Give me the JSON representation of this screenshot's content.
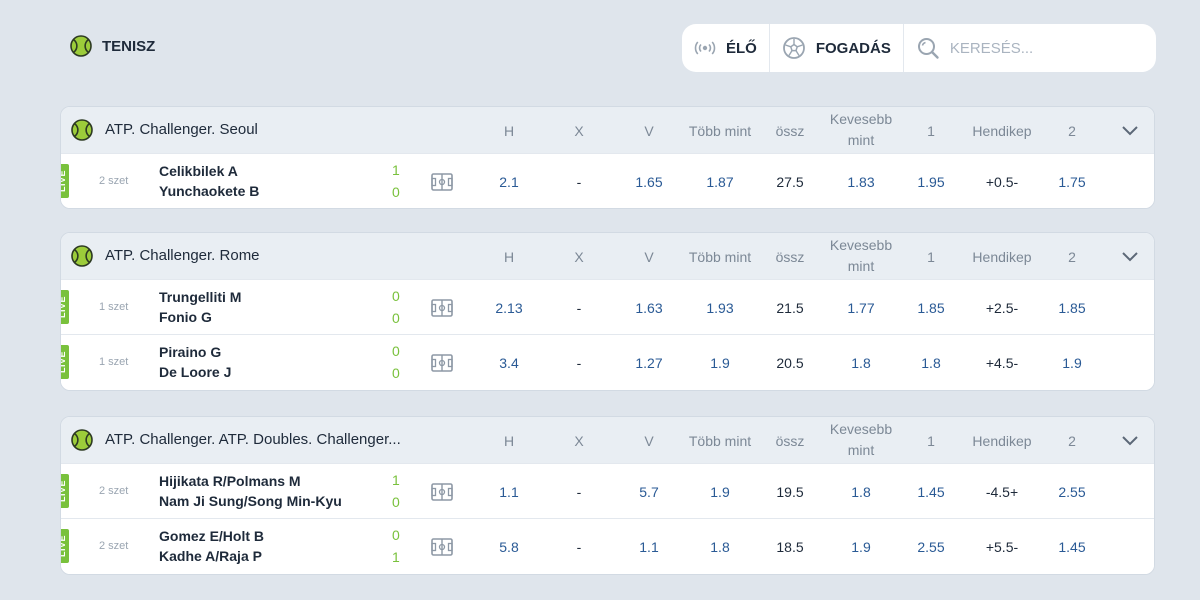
{
  "header": {
    "sport": "TENISZ",
    "live_label": "ÉLŐ",
    "bet_label": "FOGADÁS",
    "search_placeholder": "KERESÉS..."
  },
  "columns": [
    "H",
    "X",
    "V",
    "Több mint",
    "össz",
    "Kevesebb mint",
    "1",
    "Hendikep",
    "2"
  ],
  "leagues": [
    {
      "name": "ATP. Challenger. Seoul",
      "matches": [
        {
          "live": "LIVE",
          "set": "2 szet",
          "team1": "Celikbilek A",
          "team2": "Yunchaokete B",
          "score1": "1",
          "score2": "0",
          "odds": [
            "2.1",
            "-",
            "1.65",
            "1.87",
            "27.5",
            "1.83",
            "1.95",
            "+0.5-",
            "1.75"
          ]
        }
      ]
    },
    {
      "name": "ATP. Challenger. Rome",
      "matches": [
        {
          "live": "LIVE",
          "set": "1 szet",
          "team1": "Trungelliti M",
          "team2": "Fonio G",
          "score1": "0",
          "score2": "0",
          "odds": [
            "2.13",
            "-",
            "1.63",
            "1.93",
            "21.5",
            "1.77",
            "1.85",
            "+2.5-",
            "1.85"
          ]
        },
        {
          "live": "LIVE",
          "set": "1 szet",
          "team1": "Piraino G",
          "team2": "De Loore J",
          "score1": "0",
          "score2": "0",
          "odds": [
            "3.4",
            "-",
            "1.27",
            "1.9",
            "20.5",
            "1.8",
            "1.8",
            "+4.5-",
            "1.9"
          ]
        }
      ]
    },
    {
      "name": "ATP. Challenger. ATP. Doubles. Challenger...",
      "matches": [
        {
          "live": "LIVE",
          "set": "2 szet",
          "team1": "Hijikata R/Polmans M",
          "team2": "Nam Ji Sung/Song Min-Kyu",
          "score1": "1",
          "score2": "0",
          "odds": [
            "1.1",
            "-",
            "5.7",
            "1.9",
            "19.5",
            "1.8",
            "1.45",
            "-4.5+",
            "2.55"
          ]
        },
        {
          "live": "LIVE",
          "set": "2 szet",
          "team1": "Gomez E/Holt B",
          "team2": "Kadhe A/Raja P",
          "score1": "0",
          "score2": "1",
          "odds": [
            "5.8",
            "-",
            "1.1",
            "1.8",
            "18.5",
            "1.9",
            "2.55",
            "+5.5-",
            "1.45"
          ]
        }
      ]
    }
  ],
  "colors": {
    "background": "#dfe5ec",
    "live_badge": "#79c13c",
    "odd_blue": "#2a5a95",
    "header_gray": "#e9eef3"
  },
  "icons": {
    "sport": "tennis-ball-icon",
    "live": "live-broadcast-icon",
    "bet": "soccer-ball-icon",
    "search": "search-icon",
    "field": "field-icon",
    "expand": "chevron-down-icon"
  }
}
